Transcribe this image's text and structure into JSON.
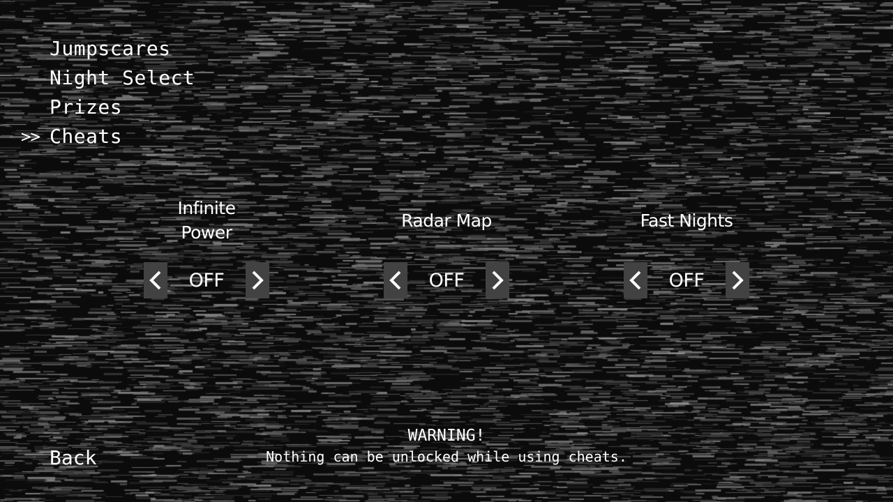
{
  "menu": {
    "selector": ">>",
    "items": [
      {
        "label": "Jumpscares",
        "selected": false
      },
      {
        "label": "Night Select",
        "selected": false
      },
      {
        "label": "Prizes",
        "selected": false
      },
      {
        "label": "Cheats",
        "selected": true
      }
    ],
    "back_label": "Back"
  },
  "cheats": [
    {
      "title_line1": "Infinite",
      "title_line2": "Power",
      "state": "OFF"
    },
    {
      "title_line1": "Radar Map",
      "title_line2": "",
      "state": "OFF"
    },
    {
      "title_line1": "Fast Nights",
      "title_line2": "",
      "state": "OFF"
    }
  ],
  "icons": {
    "left": "chevron-left-icon",
    "right": "chevron-right-icon"
  },
  "warning": {
    "title": "WARNING!",
    "message": "Nothing can be unlocked while using cheats."
  },
  "colors": {
    "background": "#0b0b0b",
    "text": "#ffffff",
    "arrow_button": "#424242"
  }
}
